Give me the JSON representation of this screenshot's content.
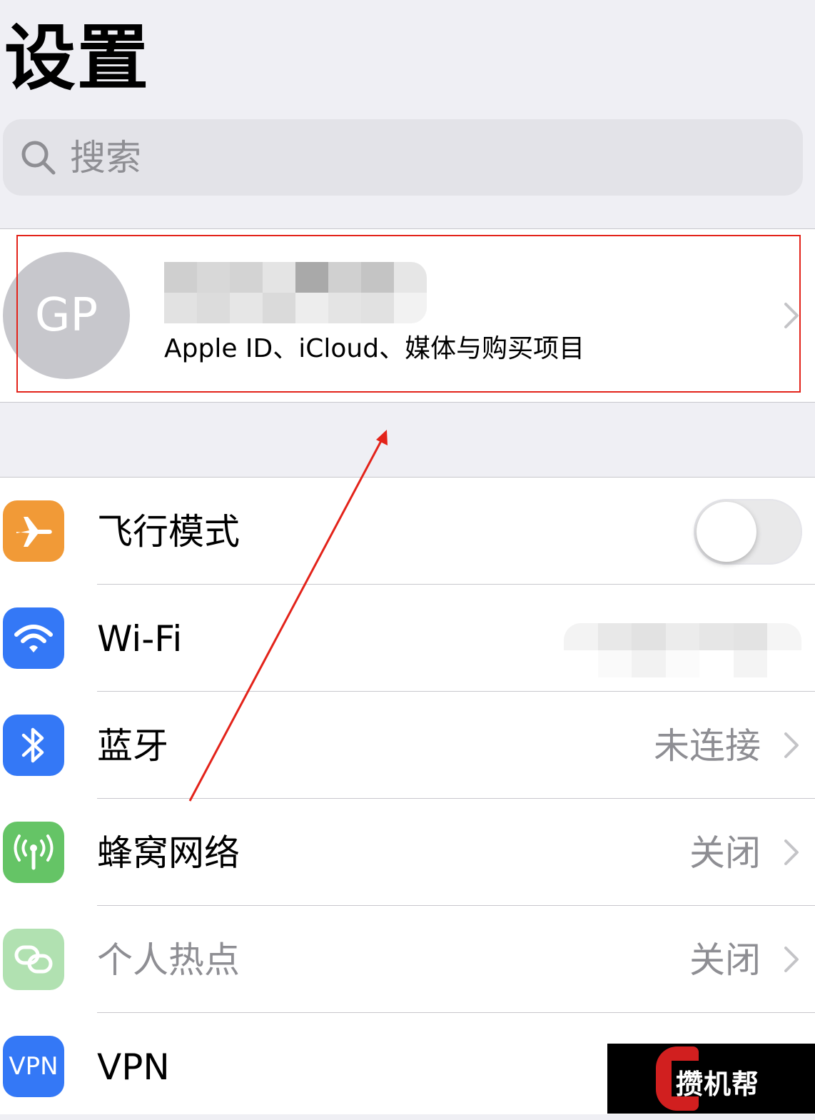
{
  "page_title": "设置",
  "search": {
    "placeholder": "搜索"
  },
  "profile": {
    "initials": "GP",
    "subtitle": "Apple ID、iCloud、媒体与购买项目"
  },
  "settings": [
    {
      "id": "airplane",
      "label": "飞行模式",
      "icon": "airplane-icon",
      "color": "#f19a37",
      "toggle": false
    },
    {
      "id": "wifi",
      "label": "Wi-Fi",
      "icon": "wifi-icon",
      "color": "#3478f6"
    },
    {
      "id": "bluetooth",
      "label": "蓝牙",
      "value": "未连接",
      "icon": "bluetooth-icon",
      "color": "#3478f6"
    },
    {
      "id": "cellular",
      "label": "蜂窝网络",
      "value": "关闭",
      "icon": "cellular-icon",
      "color": "#65c466"
    },
    {
      "id": "hotspot",
      "label": "个人热点",
      "value": "关闭",
      "icon": "hotspot-icon",
      "color": "#65c466"
    },
    {
      "id": "vpn",
      "label": "VPN",
      "icon_text": "VPN",
      "icon": "vpn-icon",
      "color": "#3478f6"
    }
  ],
  "watermark": {
    "text": "攒机帮"
  },
  "colors": {
    "highlight": "#e3231a",
    "background": "#efeff4",
    "secondary_text": "#8e8e93"
  }
}
